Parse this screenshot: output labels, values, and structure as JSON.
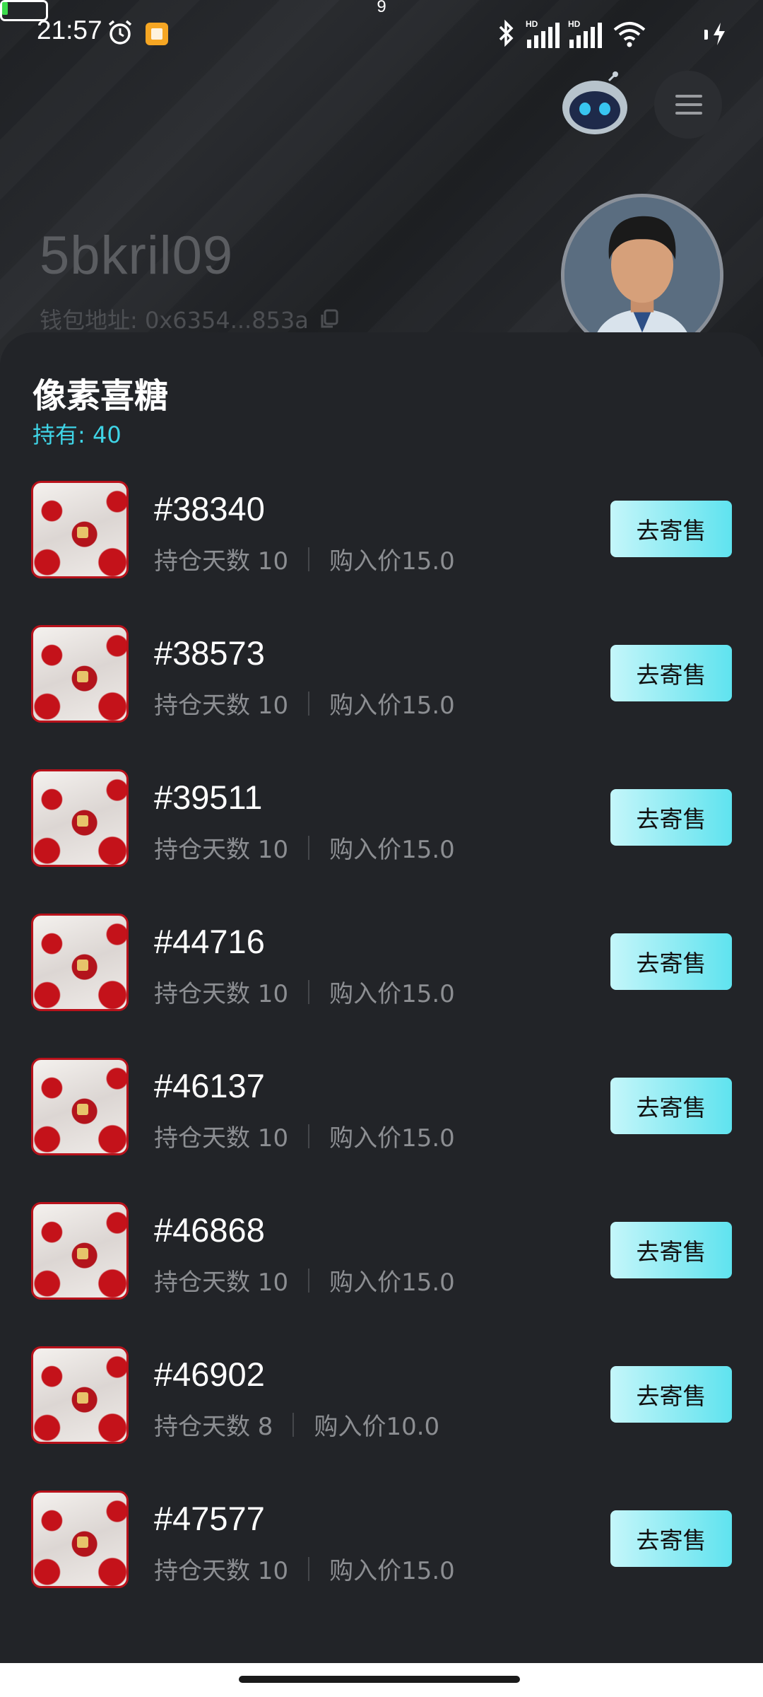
{
  "status_bar": {
    "time": "21:57",
    "battery_level": "9"
  },
  "profile": {
    "username": "5bkril09",
    "wallet_label": "钱包地址: 0x6354...853a"
  },
  "collection": {
    "title": "像素喜糖",
    "holding_label": "持有: 40"
  },
  "items": [
    {
      "id": "#38340",
      "days": "持仓天数 10",
      "price": "购入价15.0",
      "button": "去寄售"
    },
    {
      "id": "#38573",
      "days": "持仓天数 10",
      "price": "购入价15.0",
      "button": "去寄售"
    },
    {
      "id": "#39511",
      "days": "持仓天数 10",
      "price": "购入价15.0",
      "button": "去寄售"
    },
    {
      "id": "#44716",
      "days": "持仓天数 10",
      "price": "购入价15.0",
      "button": "去寄售"
    },
    {
      "id": "#46137",
      "days": "持仓天数 10",
      "price": "购入价15.0",
      "button": "去寄售"
    },
    {
      "id": "#46868",
      "days": "持仓天数 10",
      "price": "购入价15.0",
      "button": "去寄售"
    },
    {
      "id": "#46902",
      "days": "持仓天数 8",
      "price": "购入价10.0",
      "button": "去寄售"
    },
    {
      "id": "#47577",
      "days": "持仓天数 10",
      "price": "购入价15.0",
      "button": "去寄售"
    }
  ],
  "colors": {
    "accent": "#3fd4e6",
    "button_gradient_start": "#c4f6fa",
    "button_gradient_end": "#5fe3ef",
    "sheet_background": "#222428"
  },
  "icons": [
    "alarm-icon",
    "app-notification-icon",
    "bluetooth-icon",
    "signal-icon",
    "wifi-icon",
    "battery-icon",
    "charging-icon",
    "robot-assistant-icon",
    "menu-icon",
    "copy-icon",
    "avatar"
  ]
}
